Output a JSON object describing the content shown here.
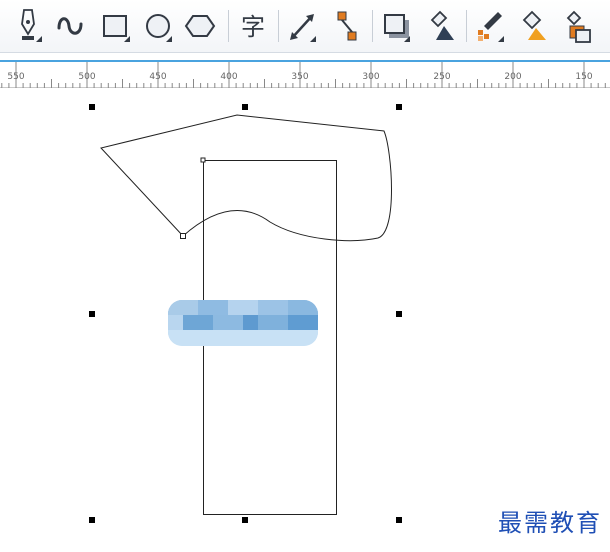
{
  "toolbar": {
    "tools": [
      {
        "name": "pen-tool-icon"
      },
      {
        "name": "freehand-curve-icon"
      },
      {
        "name": "rectangle-tool-icon"
      },
      {
        "name": "ellipse-tool-icon"
      },
      {
        "name": "polygon-tool-icon"
      },
      {
        "name": "text-tool-icon",
        "glyph": "字"
      },
      {
        "name": "dimension-tool-icon"
      },
      {
        "name": "connector-tool-icon"
      },
      {
        "name": "drop-shadow-icon"
      },
      {
        "name": "transparency-icon"
      },
      {
        "name": "color-eyedropper-icon"
      },
      {
        "name": "interactive-fill-icon"
      },
      {
        "name": "smart-fill-icon"
      }
    ]
  },
  "ruler": {
    "labels": [
      "550",
      "500",
      "450",
      "400",
      "350",
      "300",
      "250",
      "200",
      "150"
    ]
  },
  "watermark": "最需教育",
  "colors": {
    "accent": "#4aa3df",
    "icon_dark": "#333a44",
    "icon_orange": "#e07b20"
  }
}
